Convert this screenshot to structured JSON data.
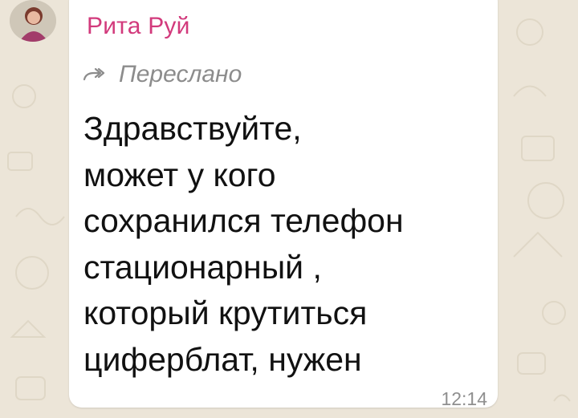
{
  "theme": {
    "wallpaper_color": "#ece5d8",
    "bubble_color": "#ffffff",
    "sender_color": "#d23a7c",
    "meta_color": "#8c8c8c",
    "text_color": "#111111"
  },
  "message": {
    "sender_name": "Рита Руй",
    "forwarded_label": "Переслано",
    "forwarded_icon": "forward-arrow-icon",
    "text": "Здравствуйте,\nможет у кого\nсохранился телефон\nстационарный ,\nкоторый крутиться\nциферблат, нужен",
    "time": "12:14",
    "avatar_icon": "user-avatar"
  }
}
